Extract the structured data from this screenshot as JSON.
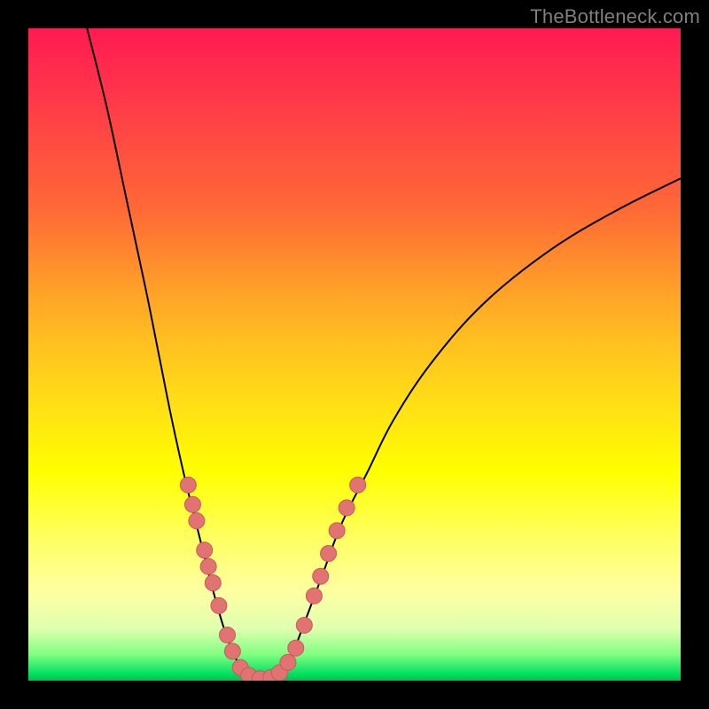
{
  "watermark": "TheBottleneck.com",
  "colors": {
    "background": "#000000",
    "curve_stroke": "#000000",
    "marker_fill": "#e17373",
    "marker_stroke": "#c85a5a"
  },
  "chart_data": {
    "type": "line",
    "title": "",
    "xlabel": "",
    "ylabel": "",
    "xlim": [
      0,
      100
    ],
    "ylim": [
      0,
      100
    ],
    "curve": {
      "left_branch": [
        {
          "x": 9.0,
          "y": 100.0
        },
        {
          "x": 12.0,
          "y": 88.0
        },
        {
          "x": 15.0,
          "y": 74.0
        },
        {
          "x": 18.0,
          "y": 60.0
        },
        {
          "x": 20.0,
          "y": 50.0
        },
        {
          "x": 22.0,
          "y": 40.0
        },
        {
          "x": 24.0,
          "y": 31.0
        },
        {
          "x": 26.0,
          "y": 23.0
        },
        {
          "x": 28.0,
          "y": 15.0
        },
        {
          "x": 30.0,
          "y": 8.0
        },
        {
          "x": 32.0,
          "y": 3.0
        },
        {
          "x": 34.0,
          "y": 0.5
        },
        {
          "x": 36.0,
          "y": 0.0
        }
      ],
      "right_branch": [
        {
          "x": 36.0,
          "y": 0.0
        },
        {
          "x": 38.0,
          "y": 0.5
        },
        {
          "x": 40.0,
          "y": 3.0
        },
        {
          "x": 42.0,
          "y": 8.0
        },
        {
          "x": 45.0,
          "y": 16.0
        },
        {
          "x": 48.0,
          "y": 24.0
        },
        {
          "x": 52.0,
          "y": 32.0
        },
        {
          "x": 56.0,
          "y": 40.0
        },
        {
          "x": 62.0,
          "y": 49.0
        },
        {
          "x": 70.0,
          "y": 58.0
        },
        {
          "x": 80.0,
          "y": 66.0
        },
        {
          "x": 90.0,
          "y": 72.0
        },
        {
          "x": 100.0,
          "y": 77.0
        }
      ]
    },
    "markers": [
      {
        "x": 24.5,
        "y": 30.0
      },
      {
        "x": 25.2,
        "y": 27.0
      },
      {
        "x": 25.8,
        "y": 24.5
      },
      {
        "x": 27.0,
        "y": 20.0
      },
      {
        "x": 27.6,
        "y": 17.5
      },
      {
        "x": 28.3,
        "y": 15.0
      },
      {
        "x": 29.2,
        "y": 11.5
      },
      {
        "x": 30.5,
        "y": 7.0
      },
      {
        "x": 31.3,
        "y": 4.5
      },
      {
        "x": 32.5,
        "y": 2.0
      },
      {
        "x": 33.8,
        "y": 0.8
      },
      {
        "x": 35.5,
        "y": 0.3
      },
      {
        "x": 37.2,
        "y": 0.5
      },
      {
        "x": 38.5,
        "y": 1.2
      },
      {
        "x": 39.8,
        "y": 2.8
      },
      {
        "x": 41.0,
        "y": 5.0
      },
      {
        "x": 42.3,
        "y": 8.5
      },
      {
        "x": 43.8,
        "y": 13.0
      },
      {
        "x": 44.8,
        "y": 16.0
      },
      {
        "x": 46.0,
        "y": 19.5
      },
      {
        "x": 47.3,
        "y": 23.0
      },
      {
        "x": 48.8,
        "y": 26.5
      },
      {
        "x": 50.5,
        "y": 30.0
      }
    ]
  }
}
